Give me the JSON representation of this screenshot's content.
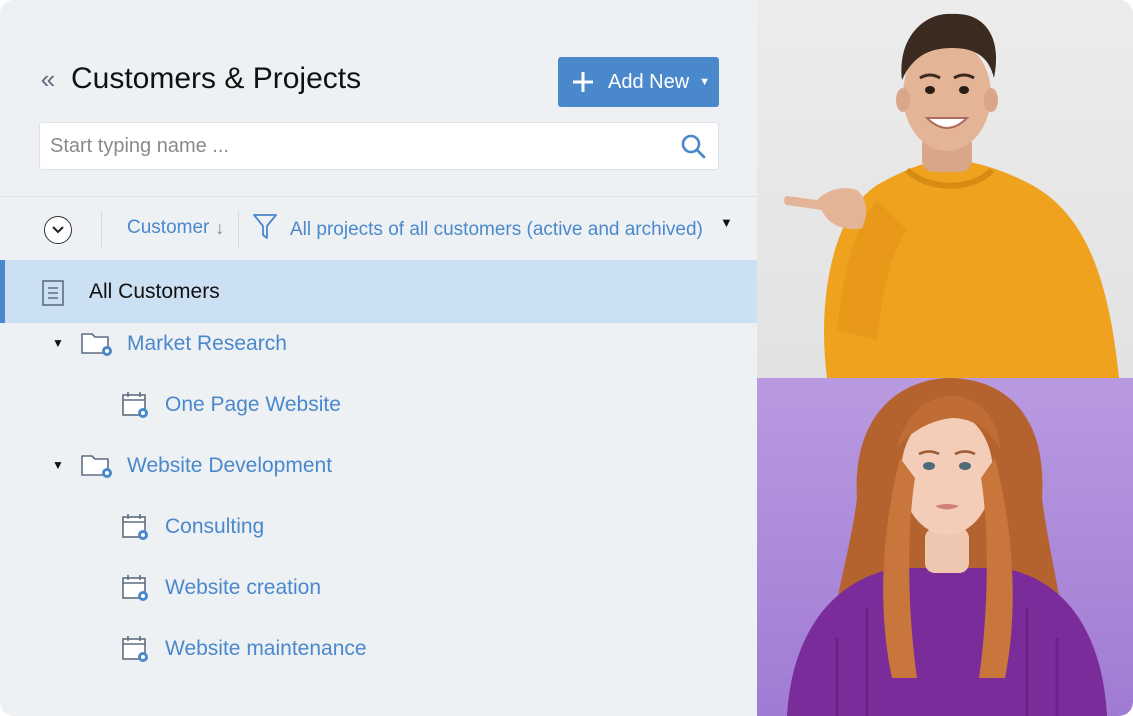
{
  "header": {
    "title": "Customers & Projects",
    "collapse_glyph": "«",
    "add_button_label": "Add New"
  },
  "search": {
    "placeholder": "Start typing name ...",
    "value": ""
  },
  "toolbar": {
    "sort_label": "Customer",
    "sort_arrow": "↓",
    "filter_label": "All projects of all customers (active and archived)"
  },
  "tree": {
    "all_customers": "All Customers",
    "customers": [
      {
        "name": "Market Research",
        "projects": [
          "One Page Website"
        ]
      },
      {
        "name": "Website Development",
        "projects": [
          "Consulting",
          "Website creation",
          "Website maintenance"
        ]
      }
    ]
  },
  "photos": {
    "top": "smiling-man-yellow-sweater",
    "bottom": "woman-purple-sweater"
  },
  "colors": {
    "accent": "#4a88cc",
    "selected_row": "#cce0f3",
    "panel_bg": "#eef1f4"
  }
}
